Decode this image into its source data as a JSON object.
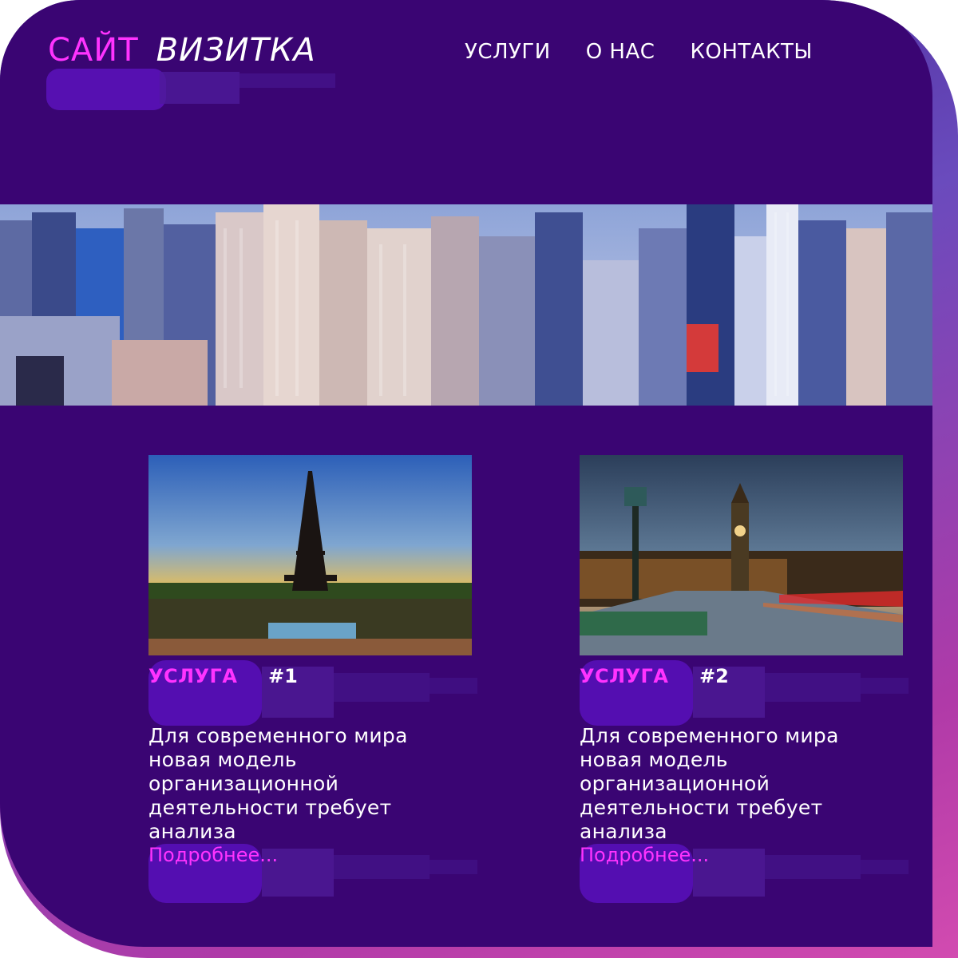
{
  "header": {
    "logo_part1": "САЙТ",
    "logo_part2": "ВИЗИТКА",
    "nav": [
      "УСЛУГИ",
      "О НАС",
      "КОНТАКТЫ"
    ]
  },
  "hero": {
    "image": "city-skyline"
  },
  "cards": [
    {
      "image": "eiffel-tower-sunset",
      "title": "УСЛУГА",
      "number": "#1",
      "description": "Для современного мира новая модель организационной деятельности требует анализа",
      "more": "Подробнее..."
    },
    {
      "image": "big-ben-bridge",
      "title": "УСЛУГА",
      "number": "#2",
      "description": "Для современного мира новая модель организационной деятельности требует анализа",
      "more": "Подробнее..."
    }
  ],
  "colors": {
    "background": "#3a0573",
    "accent": "#ff33ff",
    "text": "#ffffff",
    "border_gradient_start": "#6a4bbd",
    "border_gradient_end": "#d24bb0"
  }
}
